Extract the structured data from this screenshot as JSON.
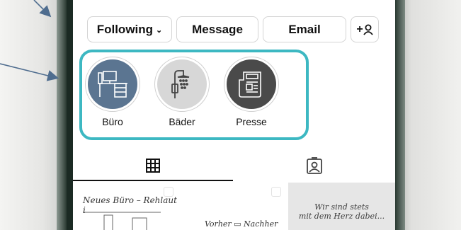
{
  "buttons": {
    "following": "Following",
    "following_chevron": "⌄",
    "message": "Message",
    "email": "Email",
    "add_person": "+"
  },
  "highlights": [
    {
      "label": "Büro",
      "icon": "desk-icon",
      "bg": "#5b7591"
    },
    {
      "label": "Bäder",
      "icon": "shower-icon",
      "bg": "#d7d7d7"
    },
    {
      "label": "Presse",
      "icon": "newspaper-icon",
      "bg": "#4a4a4a"
    }
  ],
  "tabs": {
    "grid": "grid-icon",
    "tagged": "tagged-person-icon"
  },
  "posts": {
    "p1": "Neues Büro – Rehlaut i",
    "p2": "Vorher ▭ Nachher",
    "p3_line1": "Wir sind stets",
    "p3_line2": "mit dem Herz dabei..."
  },
  "colors": {
    "highlight_border": "#3db8c2",
    "arrow": "#4f6d8f"
  }
}
